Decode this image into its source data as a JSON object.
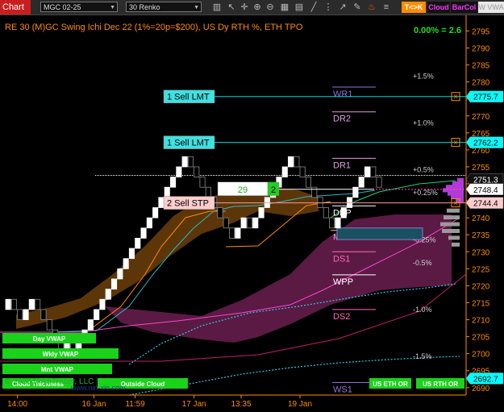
{
  "app": {
    "title": "Chart"
  },
  "toolbar": {
    "instrument": "MGC 02-25",
    "period": "30 Renko",
    "tick_button": "T<>K",
    "cloud_button": "Cloud",
    "barcol_button": "BarCol",
    "watermark_button": "W VWA",
    "icons": [
      "bar-chart-icon",
      "cursor-icon",
      "crosshair-icon",
      "zoom-in-icon",
      "zoom-out-icon",
      "properties-icon",
      "template-icon",
      "draw-line-icon",
      "draw-tools-icon",
      "arrow-icon",
      "pencil-icon",
      "flame-icon",
      "menu-icon"
    ]
  },
  "chart": {
    "header": "RE 30 (M)GC Swing Ichi Dec 22 (1%=20p=$200), US Dy RTH %, ETH TPO",
    "header_right": "0.00% = 2.6",
    "copyright": "© 2025 NinjaTrader, LLC",
    "watermark": "www.nin-xio.com",
    "axis_ticks": [
      2795,
      2790,
      2785,
      2780,
      2775,
      2770,
      2765,
      2760,
      2755,
      2750,
      2745,
      2740,
      2735,
      2730,
      2725,
      2720,
      2715,
      2710,
      2705,
      2700,
      2695,
      2690
    ],
    "ylim": [
      2689,
      2797
    ],
    "time_labels": [
      {
        "label": "14:00",
        "col": 2
      },
      {
        "label": "16 Jan",
        "col": 15
      },
      {
        "label": "11:59",
        "col": 22
      },
      {
        "label": "17 Jan",
        "col": 32
      },
      {
        "label": "13:35",
        "col": 40
      },
      {
        "label": "19 Jan",
        "col": 50
      }
    ],
    "price_badges": [
      {
        "value": "2775.7",
        "price": 2775.7,
        "color": "#00ffff",
        "text_color": "#000"
      },
      {
        "value": "2762.2",
        "price": 2762.2,
        "color": "#00ffff",
        "text_color": "#000"
      },
      {
        "value": "2751.3",
        "price": 2751.3,
        "color": "#111111",
        "text_color": "#ffffff"
      },
      {
        "value": "2748.4",
        "price": 2748.4,
        "color": "#ffffff",
        "text_color": "#000"
      },
      {
        "value": "2744.4",
        "price": 2744.4,
        "color": "#ffcccc",
        "text_color": "#000"
      },
      {
        "value": "2692.7",
        "price": 2692.7,
        "color": "#00ffff",
        "text_color": "#000"
      }
    ],
    "orders": [
      {
        "label": "1 Sell LMT",
        "price": 2775.7,
        "type": "limit"
      },
      {
        "label": "1 Sell LMT",
        "price": 2762.2,
        "type": "limit"
      },
      {
        "label": "2 Sell STP",
        "price": 2744.4,
        "type": "stop"
      }
    ],
    "position_box": {
      "count": "29",
      "qty": "2",
      "price": 2748.4
    },
    "pivots": [
      {
        "label": "WR1",
        "price": 2778.5,
        "color": "#9370db"
      },
      {
        "label": "DR2",
        "price": 2771.2,
        "color": "#dda0dd"
      },
      {
        "label": "DR1",
        "price": 2757.5,
        "color": "#dda0dd"
      },
      {
        "label": "DPP",
        "price": 2743.5,
        "color": "#ffffff"
      },
      {
        "label": "MR1",
        "price": 2736.3,
        "color": "#dda0dd"
      },
      {
        "label": "DS1",
        "price": 2730.0,
        "color": "#ff69b4"
      },
      {
        "label": "WPP",
        "price": 2723.2,
        "color": "#ffffff"
      },
      {
        "label": "DS2",
        "price": 2713.0,
        "color": "#ff69b4"
      },
      {
        "label": "WS1",
        "price": 2691.5,
        "color": "#9370db"
      }
    ],
    "pct_labels": [
      {
        "label": "+1.5%",
        "price": 2781
      },
      {
        "label": "+1.0%",
        "price": 2767.2
      },
      {
        "label": "+0.5%",
        "price": 2753.5
      },
      {
        "label": "+0.25%",
        "price": 2746.7
      },
      {
        "label": "-0.25%",
        "price": 2732.8
      },
      {
        "label": "-0.5%",
        "price": 2726
      },
      {
        "label": "-1.0%",
        "price": 2712.3
      },
      {
        "label": "-1.5%",
        "price": 2698.5
      }
    ],
    "vwap_labels": [
      {
        "label": "Day VWAP"
      },
      {
        "label": "Wkly VWAP"
      },
      {
        "label": "Mnt VWAP"
      },
      {
        "label": "Cloud Thickness"
      },
      {
        "label": "Outside Cloud"
      },
      {
        "label": "US ETH OR"
      },
      {
        "label": "US RTH OR"
      }
    ],
    "bars": [
      {
        "o": 2713,
        "c": 2716
      },
      {
        "o": 2716,
        "c": 2713
      },
      {
        "o": 2713,
        "c": 2710
      },
      {
        "o": 2710,
        "c": 2713
      },
      {
        "o": 2713,
        "c": 2716
      },
      {
        "o": 2716,
        "c": 2713
      },
      {
        "o": 2713,
        "c": 2710
      },
      {
        "o": 2710,
        "c": 2707
      },
      {
        "o": 2707,
        "c": 2704
      },
      {
        "o": 2704,
        "c": 2701
      },
      {
        "o": 2701,
        "c": 2704
      },
      {
        "o": 2704,
        "c": 2701
      },
      {
        "o": 2701,
        "c": 2704
      },
      {
        "o": 2704,
        "c": 2707
      },
      {
        "o": 2707,
        "c": 2710
      },
      {
        "o": 2710,
        "c": 2713
      },
      {
        "o": 2713,
        "c": 2716
      },
      {
        "o": 2716,
        "c": 2719
      },
      {
        "o": 2719,
        "c": 2722
      },
      {
        "o": 2722,
        "c": 2725
      },
      {
        "o": 2725,
        "c": 2728
      },
      {
        "o": 2728,
        "c": 2731
      },
      {
        "o": 2731,
        "c": 2734
      },
      {
        "o": 2734,
        "c": 2737
      },
      {
        "o": 2737,
        "c": 2740
      },
      {
        "o": 2740,
        "c": 2743
      },
      {
        "o": 2743,
        "c": 2746
      },
      {
        "o": 2746,
        "c": 2749
      },
      {
        "o": 2749,
        "c": 2752
      },
      {
        "o": 2752,
        "c": 2755
      },
      {
        "o": 2755,
        "c": 2758
      },
      {
        "o": 2758,
        "c": 2755
      },
      {
        "o": 2755,
        "c": 2752
      },
      {
        "o": 2752,
        "c": 2749
      },
      {
        "o": 2749,
        "c": 2746
      },
      {
        "o": 2746,
        "c": 2743
      },
      {
        "o": 2743,
        "c": 2740
      },
      {
        "o": 2740,
        "c": 2737
      },
      {
        "o": 2737,
        "c": 2734
      },
      {
        "o": 2734,
        "c": 2737
      },
      {
        "o": 2737,
        "c": 2740
      },
      {
        "o": 2740,
        "c": 2737
      },
      {
        "o": 2737,
        "c": 2740
      },
      {
        "o": 2740,
        "c": 2743
      },
      {
        "o": 2743,
        "c": 2746
      },
      {
        "o": 2746,
        "c": 2749
      },
      {
        "o": 2749,
        "c": 2752
      },
      {
        "o": 2752,
        "c": 2755
      },
      {
        "o": 2755,
        "c": 2758
      },
      {
        "o": 2758,
        "c": 2755
      },
      {
        "o": 2755,
        "c": 2752
      },
      {
        "o": 2752,
        "c": 2749
      },
      {
        "o": 2749,
        "c": 2746
      },
      {
        "o": 2746,
        "c": 2743
      },
      {
        "o": 2743,
        "c": 2740
      },
      {
        "o": 2740,
        "c": 2737
      },
      {
        "o": 2737,
        "c": 2740
      },
      {
        "o": 2740,
        "c": 2743
      },
      {
        "o": 2743,
        "c": 2746
      },
      {
        "o": 2746,
        "c": 2749
      },
      {
        "o": 2749,
        "c": 2752
      },
      {
        "o": 2752,
        "c": 2755
      },
      {
        "o": 2755,
        "c": 2752
      },
      {
        "o": 2752,
        "c": 2749
      }
    ],
    "colors": {
      "up": "#ffffff",
      "down": "#000000",
      "axis": "#ff8c00",
      "cloud_up": "#5c3608",
      "cloud_down": "#5a1a44",
      "order_line": "#00d7d7",
      "stop_line": "#ff9999"
    }
  }
}
